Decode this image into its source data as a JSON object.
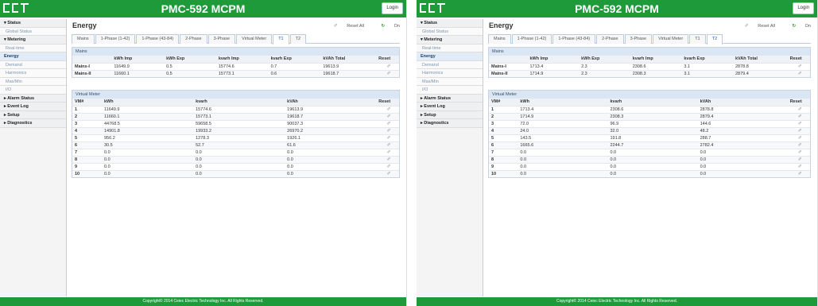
{
  "app_title": "PMC-592 MCPM",
  "login_label": "Login",
  "page_title": "Energy",
  "reset_all_label": "Reset All",
  "on_label": "On",
  "footer": "Copyright© 2014 Ceiec Electric Technology Inc. All Rights Reserved.",
  "icons": {
    "reset": "✐",
    "reset_all": "✐",
    "refresh": "↻"
  },
  "colors": {
    "header": "#1f9a3a",
    "panel_head": "#dae6f3"
  },
  "sidebar": [
    {
      "label": "▾ Status",
      "type": "sec"
    },
    {
      "label": "Global Status",
      "type": "sub"
    },
    {
      "label": "▾ Metering",
      "type": "sec"
    },
    {
      "label": "Real-time",
      "type": "sub"
    },
    {
      "label": "Energy",
      "type": "act"
    },
    {
      "label": "Demand",
      "type": "sub"
    },
    {
      "label": "Harmonics",
      "type": "sub"
    },
    {
      "label": "Max/Min",
      "type": "sub"
    },
    {
      "label": "I/O",
      "type": "sub"
    },
    {
      "label": "▸ Alarm Status",
      "type": "sec"
    },
    {
      "label": "▸ Event Log",
      "type": "sec"
    },
    {
      "label": "▸ Setup",
      "type": "sec"
    },
    {
      "label": "▸ Diagnostics",
      "type": "sec"
    }
  ],
  "tabs": [
    "Mains",
    "1-Phase (1-42)",
    "1-Phase (43-84)",
    "2-Phase",
    "3-Phase",
    "Virtual Meter",
    "T1",
    "T2"
  ],
  "mains_section": "Mains",
  "virtual_section": "Virtual Meter",
  "mains_columns": [
    "",
    "kWh Imp",
    "kWh Exp",
    "kvarh Imp",
    "kvarh Exp",
    "kVAh Total",
    "Reset"
  ],
  "vm_columns": [
    "VM#",
    "kWh",
    "kvarh",
    "kVAh",
    "Reset"
  ],
  "screens": [
    {
      "active_tab": 6,
      "mains_rows": [
        [
          "Mains-I",
          "11649.9",
          "0.5",
          "15774.6",
          "0.7",
          "19613.9"
        ],
        [
          "Mains-II",
          "11660.1",
          "0.5",
          "15773.1",
          "0.6",
          "19618.7"
        ]
      ],
      "vm_rows": [
        [
          "1",
          "11649.9",
          "15774.6",
          "19613.9"
        ],
        [
          "2",
          "11660.1",
          "15773.1",
          "19618.7"
        ],
        [
          "3",
          "44768.5",
          "59658.5",
          "90037.3"
        ],
        [
          "4",
          "14901.8",
          "19933.2",
          "26970.2"
        ],
        [
          "5",
          "956.2",
          "1278.3",
          "1926.1"
        ],
        [
          "6",
          "30.5",
          "52.7",
          "61.6"
        ],
        [
          "7",
          "0.0",
          "0.0",
          "0.0"
        ],
        [
          "8",
          "0.0",
          "0.0",
          "0.0"
        ],
        [
          "9",
          "0.0",
          "0.0",
          "0.0"
        ],
        [
          "10",
          "0.0",
          "0.0",
          "0.0"
        ]
      ]
    },
    {
      "active_tab": 7,
      "mains_rows": [
        [
          "Mains-I",
          "1713.4",
          "2.3",
          "2308.6",
          "3.1",
          "2878.8"
        ],
        [
          "Mains-II",
          "1714.9",
          "2.3",
          "2308.3",
          "3.1",
          "2879.4"
        ]
      ],
      "vm_rows": [
        [
          "1",
          "1713.4",
          "2308.6",
          "2878.8"
        ],
        [
          "2",
          "1714.9",
          "2308.3",
          "2879.4"
        ],
        [
          "3",
          "72.0",
          "96.9",
          "144.6"
        ],
        [
          "4",
          "24.0",
          "32.0",
          "48.2"
        ],
        [
          "5",
          "143.5",
          "191.8",
          "288.7"
        ],
        [
          "6",
          "1665.6",
          "2244.7",
          "2782.4"
        ],
        [
          "7",
          "0.0",
          "0.0",
          "0.0"
        ],
        [
          "8",
          "0.0",
          "0.0",
          "0.0"
        ],
        [
          "9",
          "0.0",
          "0.0",
          "0.0"
        ],
        [
          "10",
          "0.0",
          "0.0",
          "0.0"
        ]
      ]
    }
  ]
}
